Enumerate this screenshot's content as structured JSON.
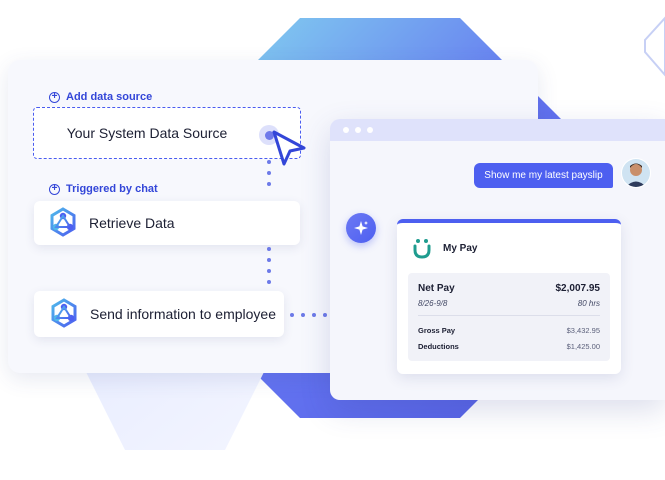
{
  "flow": {
    "add_source_label": "Add data source",
    "source_box_text": "Your System Data Source",
    "triggered_label": "Triggered by chat",
    "step1_label": "Retrieve Data",
    "step2_label": "Send information to employee",
    "icon": "workflow-hexagon-icon"
  },
  "chat": {
    "user_message": "Show me my latest payslip",
    "ai_icon": "sparkle-icon",
    "pay_card": {
      "title": "My Pay",
      "net_pay_label": "Net Pay",
      "net_pay_value": "$2,007.95",
      "period": "8/26-9/8",
      "hours": "80 hrs",
      "gross_pay_label": "Gross Pay",
      "gross_pay_value": "$3,432.95",
      "deductions_label": "Deductions",
      "deductions_value": "$1,425.00"
    }
  },
  "colors": {
    "accent": "#4d5ff0",
    "label_blue": "#3346d8",
    "logo_teal": "#1f9c8f"
  }
}
